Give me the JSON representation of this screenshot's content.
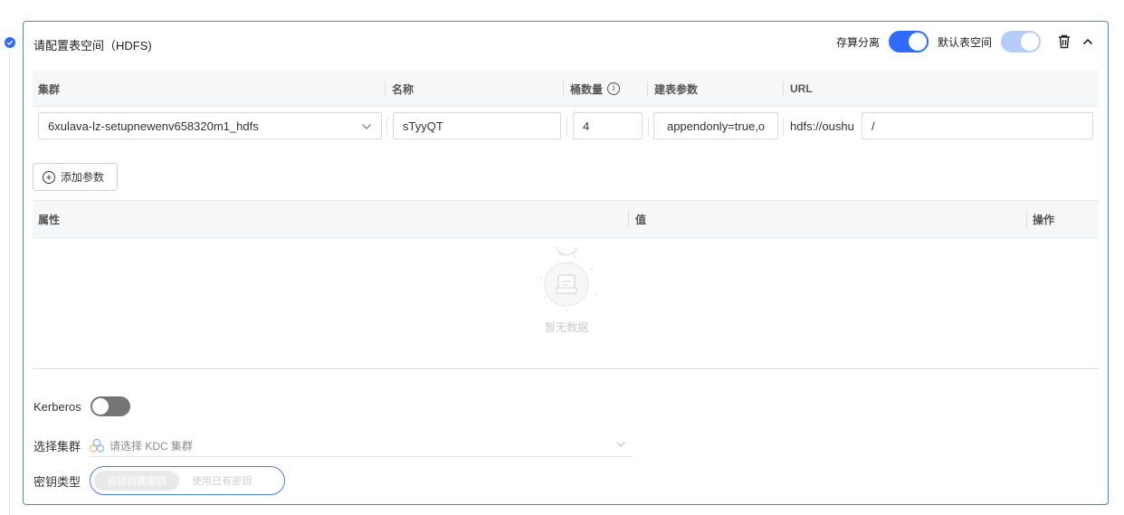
{
  "section": {
    "title": "请配置表空间（HDFS)",
    "storage_compute_label": "存算分离",
    "default_tablespace_label": "默认表空间"
  },
  "columns": {
    "cluster": "集群",
    "name": "名称",
    "bucket_count": "桶数量",
    "table_params": "建表参数",
    "url": "URL"
  },
  "row": {
    "cluster_value": "6xulava-lz-setupnewenv658320m1_hdfs",
    "name_value": "sTyyQT",
    "bucket_value": "4",
    "params_value": "appendonly=true,o",
    "url_prefix": "hdfs://oushu",
    "url_path": "/"
  },
  "add_param_label": "添加参数",
  "props_table": {
    "col_attr": "属性",
    "col_value": "值",
    "col_action": "操作",
    "empty_text": "暂无数据"
  },
  "kerberos": {
    "label": "Kerberos",
    "enabled": false
  },
  "select_cluster": {
    "label": "选择集群",
    "placeholder": "请选择 KDC 集群"
  },
  "key_type": {
    "label": "密钥类型",
    "options": [
      "自动创建密钥",
      "使用已有密钥"
    ]
  },
  "colors": {
    "accent": "#2f6bff",
    "border_active": "#4a7cf7"
  }
}
